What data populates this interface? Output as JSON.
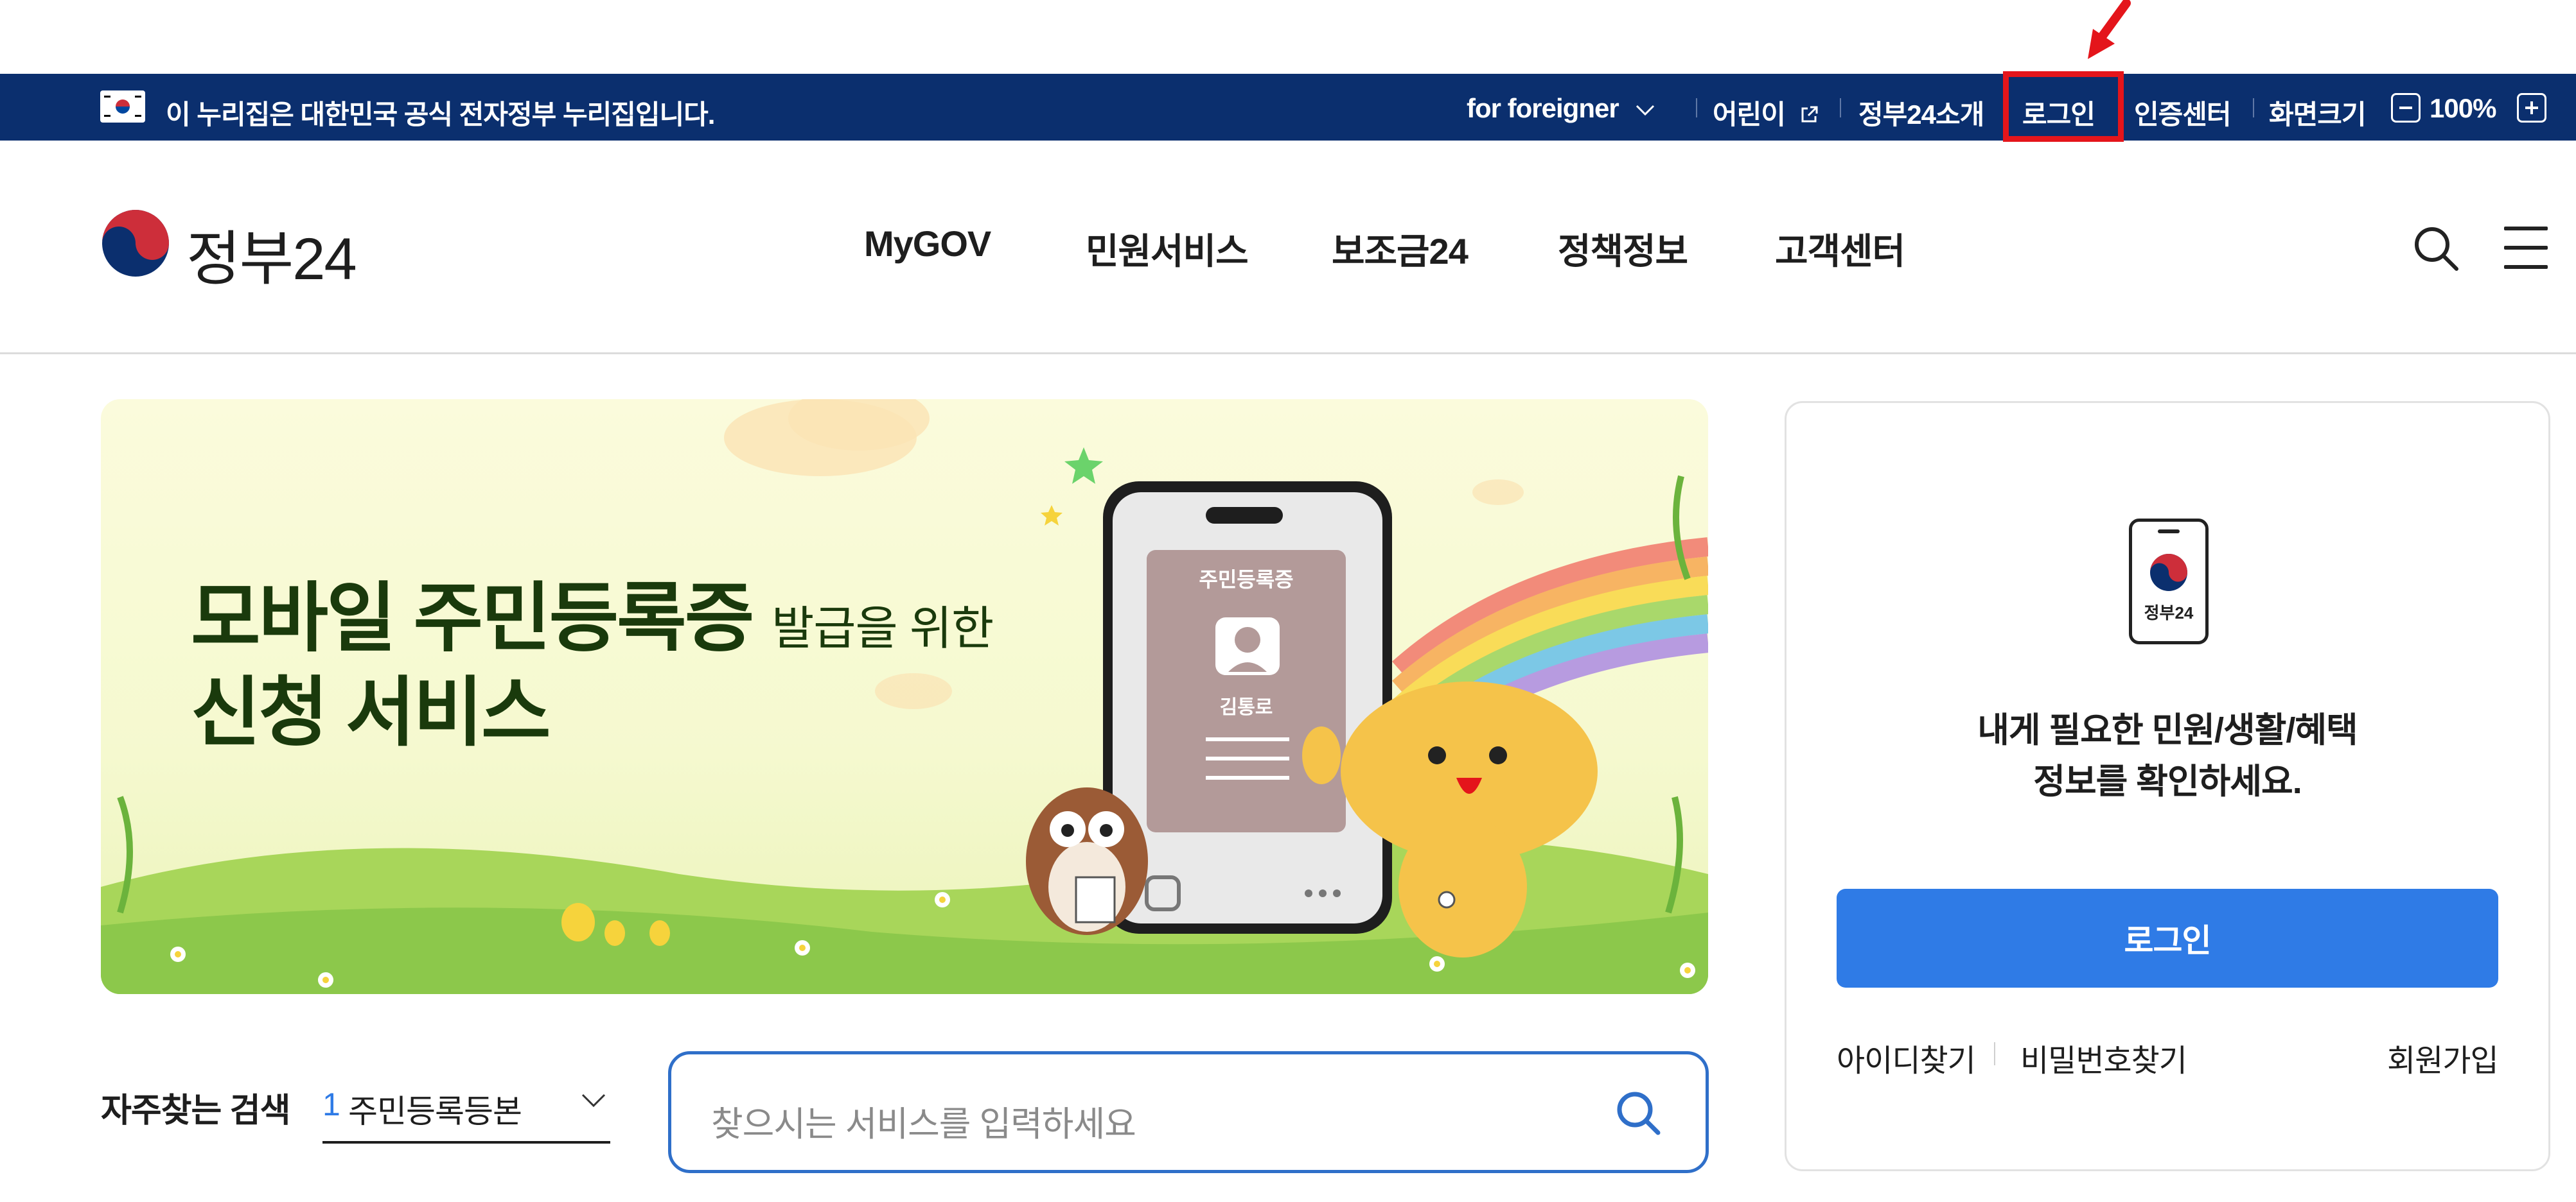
{
  "topbar": {
    "notice": "이 누리집은 대한민국 공식 전자정부 누리집입니다.",
    "links": {
      "foreigner": "for foreigner",
      "kids": "어린이",
      "about": "정부24소개",
      "login": "로그인",
      "cert": "인증센터",
      "screen": "화면크기",
      "zoom": "100%"
    }
  },
  "header": {
    "logo_text": "정부24",
    "nav": [
      "MyGOV",
      "민원서비스",
      "보조금24",
      "정책정보",
      "고객센터"
    ]
  },
  "hero": {
    "title_main": "모바일 주민등록증",
    "title_suffix": "발급을 위한",
    "title_line2": "신청 서비스",
    "card_title": "주민등록증",
    "card_name": "김통로"
  },
  "login_card": {
    "phone_label": "정부24",
    "message_line1": "내게 필요한 민원/생활/혜택",
    "message_line2": "정보를 확인하세요.",
    "login_button": "로그인",
    "find_id": "아이디찾기",
    "find_pw": "비밀번호찾기",
    "signup": "회원가입"
  },
  "search": {
    "freq_label": "자주찾는 검색",
    "freq_rank": "1",
    "freq_value": "주민등록등본",
    "placeholder": "찾으시는 서비스를 입력하세요"
  },
  "colors": {
    "topbar_bg": "#0b2f6e",
    "accent_blue": "#2f7be6",
    "highlight_red": "#e4151b"
  }
}
